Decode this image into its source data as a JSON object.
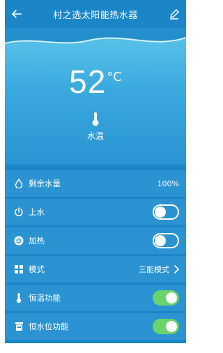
{
  "header": {
    "title": "村之选太阳能热水器",
    "back_icon": "arrow-left-icon",
    "edit_icon": "pencil-icon"
  },
  "status": {
    "temperature": "52",
    "unit": "°C",
    "water_temp_label": "水温"
  },
  "rows": {
    "water_level": {
      "label": "剩余水量",
      "value": "100%",
      "icon": "water-drop-icon"
    },
    "fill_water": {
      "label": "上水",
      "icon": "power-icon",
      "toggle_on": false
    },
    "heating": {
      "label": "加热",
      "icon": "power-circle-icon",
      "toggle_on": false
    },
    "mode": {
      "label": "模式",
      "value": "三能模式",
      "icon": "grid-icon"
    },
    "constant_temp": {
      "label": "恒温功能",
      "icon": "thermometer-icon",
      "toggle_on": true
    },
    "constant_level": {
      "label": "恒水位功能",
      "icon": "tank-icon",
      "toggle_on": true
    }
  },
  "colors": {
    "primary": "#1a86c8",
    "row_bg": "#2b93d1",
    "toggle_on": "#6bd36b"
  }
}
